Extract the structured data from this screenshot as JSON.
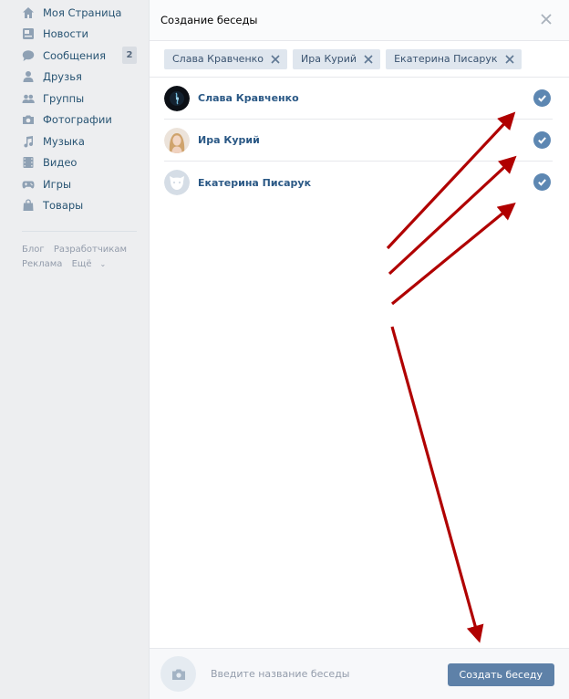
{
  "sidebar": {
    "items": [
      {
        "label": "Моя Страница",
        "icon": "home-icon"
      },
      {
        "label": "Новости",
        "icon": "news-icon"
      },
      {
        "label": "Сообщения",
        "icon": "messages-icon",
        "badge": "2"
      },
      {
        "label": "Друзья",
        "icon": "friends-icon"
      },
      {
        "label": "Группы",
        "icon": "groups-icon"
      },
      {
        "label": "Фотографии",
        "icon": "camera-icon"
      },
      {
        "label": "Музыка",
        "icon": "music-icon"
      },
      {
        "label": "Видео",
        "icon": "video-icon"
      },
      {
        "label": "Игры",
        "icon": "gamepad-icon"
      },
      {
        "label": "Товары",
        "icon": "shopping-bag-icon"
      }
    ],
    "footer_links": {
      "blog": "Блог",
      "developers": "Разработчикам",
      "ads": "Реклама",
      "more": "Ещё"
    }
  },
  "dialog": {
    "title": "Создание беседы",
    "chips": [
      {
        "label": "Слава Кравченко"
      },
      {
        "label": "Ира Курий"
      },
      {
        "label": "Екатерина Писарук"
      }
    ],
    "friends": [
      {
        "name": "Слава Кравченко",
        "selected": true
      },
      {
        "name": "Ира Курий",
        "selected": true
      },
      {
        "name": "Екатерина Писарук",
        "selected": true
      }
    ],
    "footer": {
      "name_placeholder": "Введите название беседы",
      "create_label": "Создать беседу"
    }
  },
  "colors": {
    "accent": "#5e81a8",
    "link": "#2a5885",
    "arrow": "#b00000"
  }
}
